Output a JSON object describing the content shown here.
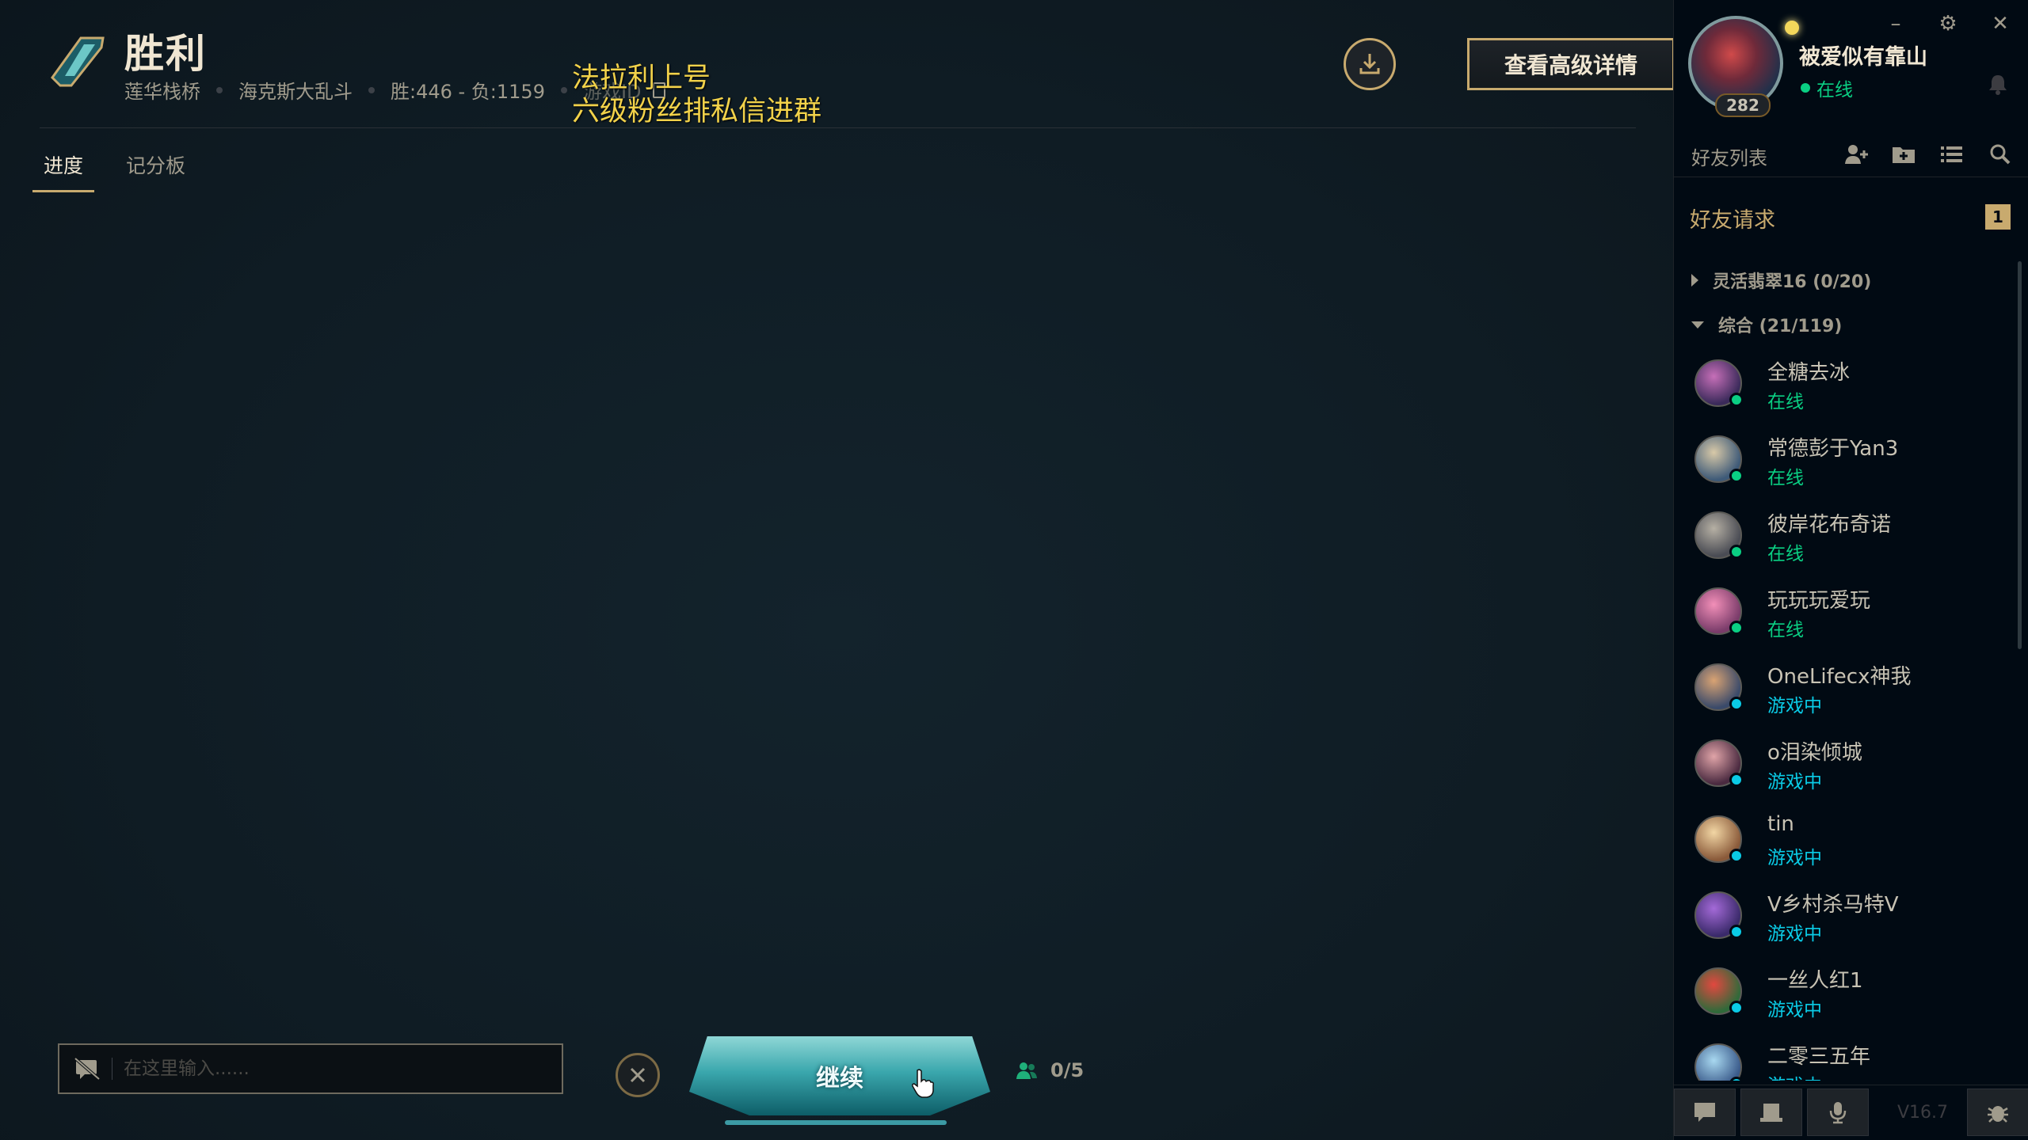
{
  "header": {
    "result_title": "胜利",
    "map": "莲华栈桥",
    "mode": "海克斯大乱斗",
    "record": "胜:446 - 负:1159",
    "game_id_label": "游戏ID",
    "details_button": "查看高级详情"
  },
  "overlay": {
    "line1": "法拉利上号",
    "line2": "六级粉丝排私信进群"
  },
  "tabs": [
    {
      "label": "进度",
      "active": true
    },
    {
      "label": "记分板",
      "active": false
    }
  ],
  "chat": {
    "placeholder": "在这里输入......"
  },
  "continue_button": "继续",
  "party": {
    "count": "0/5"
  },
  "profile": {
    "name": "被爱似有靠山",
    "status": "在线",
    "level": "282"
  },
  "friends_panel": {
    "title": "好友列表",
    "friend_requests": "好友请求",
    "friend_request_count": "1",
    "groups": [
      {
        "label": "灵活翡翠16 (0/20)",
        "expanded": false
      },
      {
        "label": "综合 (21/119)",
        "expanded": true
      }
    ],
    "friends": [
      {
        "name": "全糖去冰",
        "status": "在线",
        "state": "online"
      },
      {
        "name": "常德彭于Yan3",
        "status": "在线",
        "state": "online"
      },
      {
        "name": "彼岸花布奇诺",
        "status": "在线",
        "state": "online"
      },
      {
        "name": "玩玩玩爱玩",
        "status": "在线",
        "state": "online"
      },
      {
        "name": "OneLifecx神我",
        "status": "游戏中",
        "state": "ingame"
      },
      {
        "name": "o泪染倾城",
        "status": "游戏中",
        "state": "ingame"
      },
      {
        "name": "tin",
        "status": "游戏中",
        "state": "ingame"
      },
      {
        "name": "V乡村杀马特V",
        "status": "游戏中",
        "state": "ingame"
      },
      {
        "name": "一丝人红1",
        "status": "游戏中",
        "state": "ingame"
      },
      {
        "name": "二零三五年",
        "status": "游戏中",
        "state": "ingame"
      }
    ]
  },
  "version": "V16.7",
  "colors": {
    "gold": "#c8aa6e",
    "online": "#0acf83",
    "ingame": "#0acbe6",
    "background": "#0f1a22"
  },
  "icons": {
    "result": "victory-crystal-icon",
    "download": "download-icon",
    "close": "close-icon",
    "party": "party-icon",
    "mute": "chat-mute-icon"
  }
}
